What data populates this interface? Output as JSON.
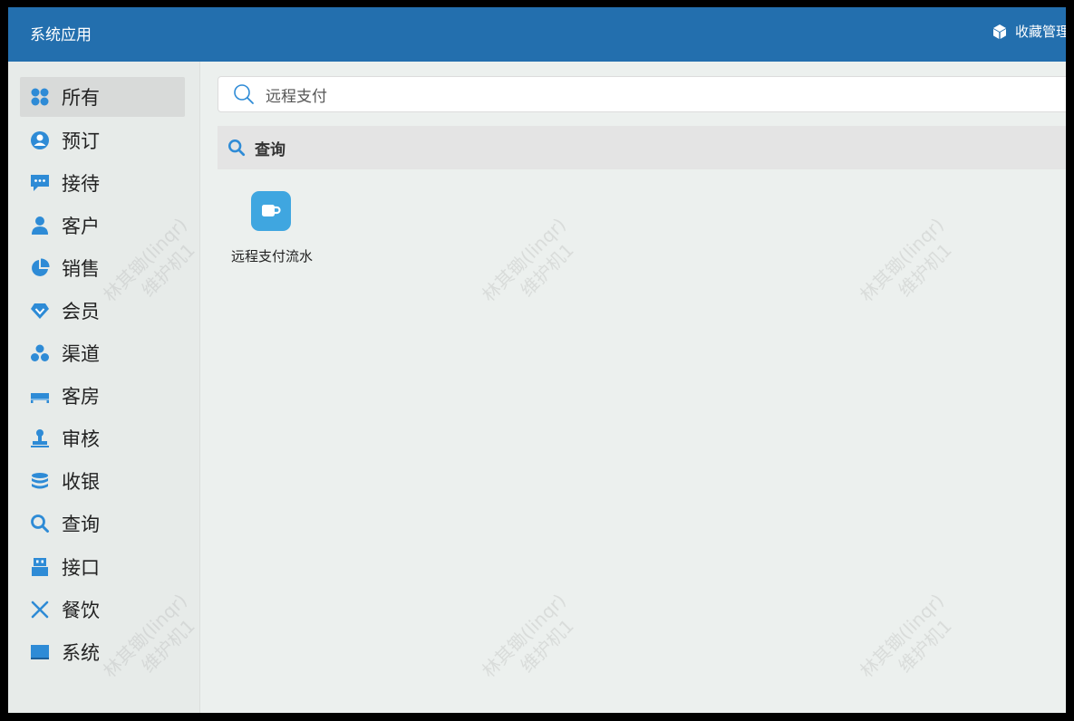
{
  "header": {
    "title": "系统应用",
    "favorites_label": "收藏管理",
    "favorites_icon": "cube-icon"
  },
  "sidebar": {
    "items": [
      {
        "label": "所有",
        "icon": "grid-icon",
        "active": true
      },
      {
        "label": "预订",
        "icon": "user-circle-icon"
      },
      {
        "label": "接待",
        "icon": "chat-bubble-icon"
      },
      {
        "label": "客户",
        "icon": "person-icon"
      },
      {
        "label": "销售",
        "icon": "pie-chart-icon"
      },
      {
        "label": "会员",
        "icon": "diamond-icon"
      },
      {
        "label": "渠道",
        "icon": "cluster-icon"
      },
      {
        "label": "客房",
        "icon": "bed-icon"
      },
      {
        "label": "审核",
        "icon": "stamp-icon"
      },
      {
        "label": "收银",
        "icon": "database-icon"
      },
      {
        "label": "查询",
        "icon": "search-icon"
      },
      {
        "label": "接口",
        "icon": "usb-icon"
      },
      {
        "label": "餐饮",
        "icon": "utensils-icon"
      },
      {
        "label": "系统",
        "icon": "monitor-icon"
      }
    ]
  },
  "search": {
    "value": "远程支付",
    "icon": "search-icon"
  },
  "section": {
    "label": "查询",
    "icon": "search-icon"
  },
  "apps": [
    {
      "label": "远程支付流水",
      "icon": "coffee-cup-icon"
    }
  ],
  "watermark": {
    "line1": "林其锄(linqr)",
    "line2": "维护机1"
  },
  "colors": {
    "header_bg": "#236fae",
    "accent_icon": "#2e8bd6",
    "app_icon_bg": "#3fa6e0"
  }
}
